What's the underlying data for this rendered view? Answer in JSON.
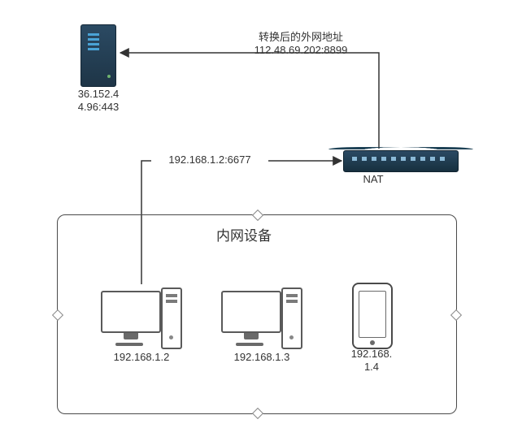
{
  "top_arrow": {
    "label_line1": "转换后的外网地址",
    "label_line2": "112.48.69.202:8899"
  },
  "server": {
    "ip_line1": "36.152.4",
    "ip_line2": "4.96:443"
  },
  "nat": {
    "label": "NAT",
    "incoming_label": "192.168.1.2:6677"
  },
  "lan": {
    "title": "内网设备",
    "devices": [
      {
        "ip": "192.168.1.2"
      },
      {
        "ip": "192.168.1.3"
      },
      {
        "ip_line1": "192.168.",
        "ip_line2": "1.4"
      }
    ]
  }
}
